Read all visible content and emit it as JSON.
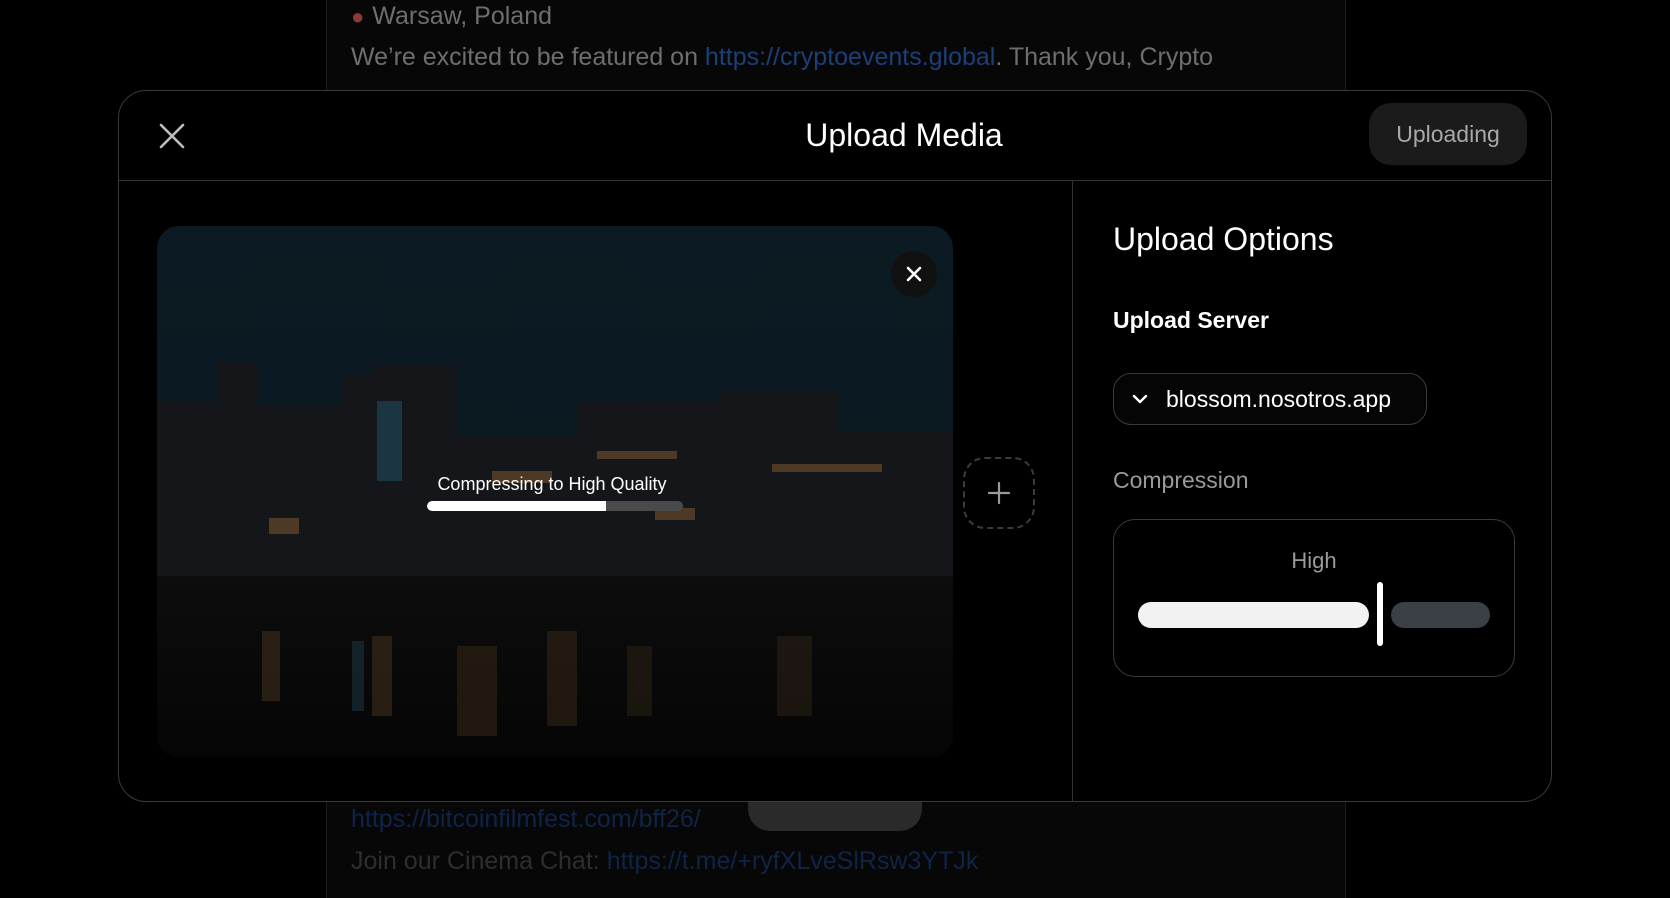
{
  "background_feed": {
    "location": "Warsaw, Poland",
    "line1_prefix": "We’re excited to be featured on ",
    "line1_link": "https://cryptoevents.global",
    "line1_suffix": ". Thank you, Crypto",
    "link2": "https://bitcoinfilmfest.com/bff26/",
    "line3_prefix": "Join our Cinema Chat: ",
    "line3_link": "https://t.me/+ryfXLveSlRsw3YTJk"
  },
  "modal": {
    "title": "Upload Media",
    "close_icon": "close-icon",
    "uploading_label": "Uploading"
  },
  "media": {
    "progress_label": "Compressing to High Quality",
    "progress": 0.7,
    "remove_icon": "close-icon",
    "add_icon": "plus-icon"
  },
  "options": {
    "title": "Upload Options",
    "server_label": "Upload Server",
    "server_value": "blossom.nosotros.app",
    "compression_label": "Compression",
    "compression_value": "High",
    "compression_level": 0.68
  },
  "colors": {
    "link": "#1d3f78",
    "modal_border": "#3a3a3a",
    "slider_track": "#3b3f46"
  }
}
